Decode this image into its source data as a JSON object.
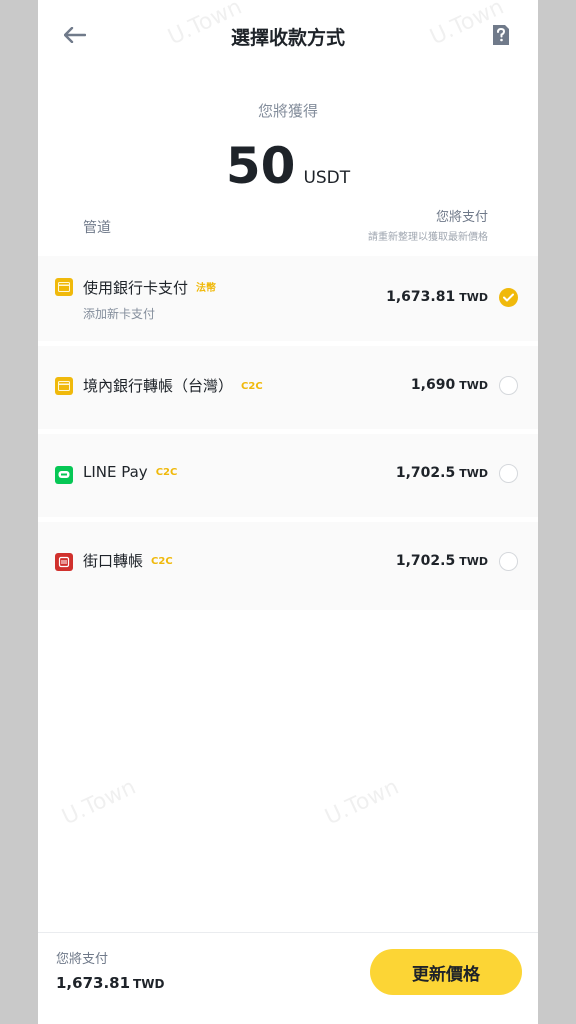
{
  "header": {
    "title": "選擇收款方式",
    "back_icon": "arrow-left-icon",
    "help_icon": "help-document-icon"
  },
  "receive": {
    "label": "您將獲得",
    "amount": "50",
    "unit": "USDT"
  },
  "columns": {
    "channel": "管道",
    "pay": "您將支付",
    "hint": "請重新整理以獲取最新價格"
  },
  "methods": [
    {
      "name": "使用銀行卡支付",
      "tag": "法幣",
      "sub": "添加新卡支付",
      "price": "1,673.81",
      "currency": "TWD",
      "selected": true,
      "icon": "bank-card-icon",
      "icon_color": "#f0b90b"
    },
    {
      "name": "境內銀行轉帳（台灣）",
      "tag": "C2C",
      "sub": "",
      "price": "1,690",
      "currency": "TWD",
      "selected": false,
      "icon": "bank-card-icon",
      "icon_color": "#f0b90b"
    },
    {
      "name": "LINE Pay",
      "tag": "C2C",
      "sub": "",
      "price": "1,702.5",
      "currency": "TWD",
      "selected": false,
      "icon": "line-icon",
      "icon_color": "#06c755"
    },
    {
      "name": "街口轉帳",
      "tag": "C2C",
      "sub": "",
      "price": "1,702.5",
      "currency": "TWD",
      "selected": false,
      "icon": "jkopay-icon",
      "icon_color": "#d0312d"
    }
  ],
  "footer": {
    "label": "您將支付",
    "price": "1,673.81",
    "currency": "TWD",
    "button": "更新價格"
  },
  "watermark": "U.Town",
  "colors": {
    "accent": "#f0b90b",
    "button": "#fcd535",
    "text": "#1e2329",
    "muted": "#848e9c"
  }
}
